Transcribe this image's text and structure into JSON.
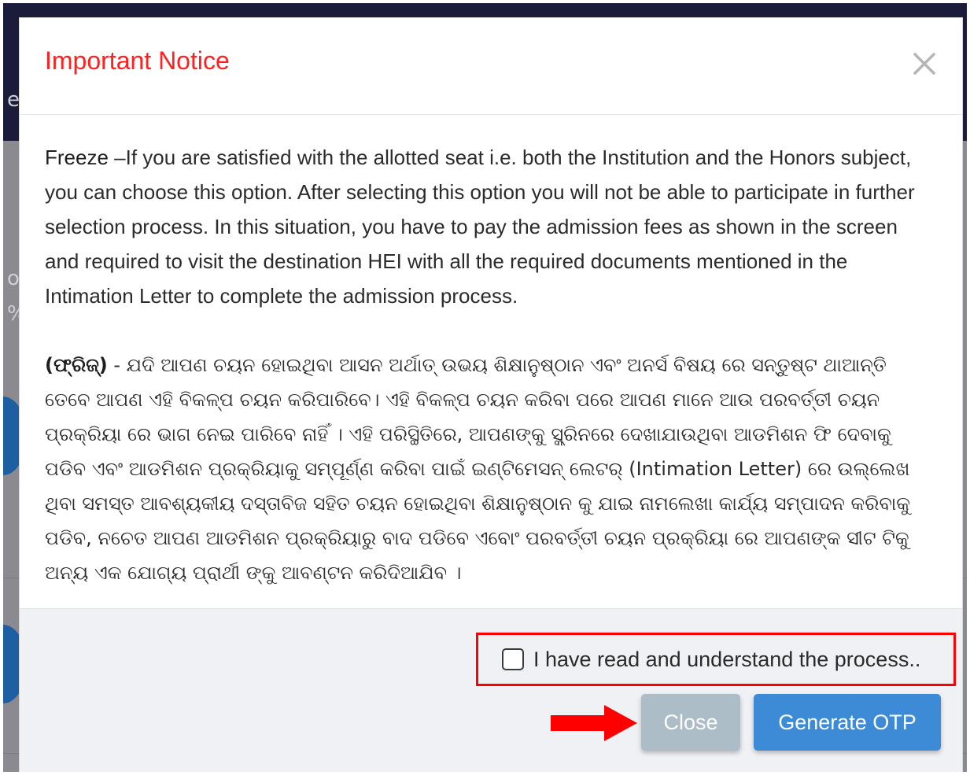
{
  "colors": {
    "title_red": "#ff2020",
    "highlight_red": "#ff0000",
    "close_button_bg": "#adbdc8",
    "primary_button_bg": "#3d8bd6"
  },
  "modal": {
    "title": "Important Notice",
    "close_icon": "close-icon",
    "body": {
      "english": {
        "lead": "Freeze",
        "text": " –If you are satisfied with the allotted seat i.e. both the Institution and the Honors subject, you can choose this option. After selecting this option you will not be able to participate in further selection process. In this situation, you have to pay the admission fees as shown in the screen and required to visit the destination HEI with all the required documents mentioned in the Intimation Letter to complete the admission process."
      },
      "odia": {
        "lead": "(ଫ୍ରିଜ୍)",
        "text": " - ଯଦି ଆପଣ ଚୟନ ହୋଇଥିବା ଆସନ ଅର୍ଥାତ୍ ଉଭୟ ଶିକ୍ଷାନୁଷ୍ଠାନ ଏବଂ ଅନର୍ସ ବିଷୟ ରେ ସନ୍ତୁଷ୍ଟ ଥାଆନ୍ତି ତେବେ ଆପଣ ଏହି ବିକଳ୍ପ ଚୟନ କରିପାରିବେ। ଏହି ବିକଳ୍ପ ଚୟନ କରିବା ପରେ ଆପଣ ମାନେ ଆଉ ପରବର୍ତ୍ତୀ ଚୟନ ପ୍ରକ୍ରିୟା ରେ ଭାଗ ନେଇ ପାରିବେ ନାହିଁ । ଏହି ପରିସ୍ଥିତିରେ, ଆପଣଙ୍କୁ ସ୍କ୍ରିନରେ ଦେଖାଯାଉଥିବା ଆଡମିଶନ ଫି ଦେବାକୁ ପଡିବ ଏବଂ ଆଡମିଶନ ପ୍ରକ୍ରିୟାକୁ ସମ୍ପୂର୍ଣ୍ଣ କରିବା ପାଇଁ ଇଣ୍ଟିମେସନ୍ ଲେଟର୍ (Intimation Letter) ରେ ଉଲ୍ଲେଖ ଥିବା ସମସ୍ତ ଆବଶ୍ୟକୀୟ ଦସ୍ତାବିଜ ସହିତ ଚୟନ ହୋଇଥିବା ଶିକ୍ଷାନୁଷ୍ଠାନ କୁ ଯାଇ ନାମଲେଖା କାର୍ଯ୍ୟ ସମ୍ପାଦନ କରିବାକୁ ପଡିବ, ନଚେତ ଆପଣ ଆଡମିଶନ ପ୍ରକ୍ରିୟାରୁ ବାଦ ପଡିବେ ଏବୋଂ ପରବର୍ତ୍ତୀ ଚୟନ ପ୍ରକ୍ରିୟା ରେ ଆପଣଙ୍କ ସୀଟ ଟିକୁ ଅନ୍ୟ ଏକ ଯୋଗ୍ୟ ପ୍ରାର୍ଥୀ ଙ୍କୁ ଆବଣ୍ଟନ କରିଦିଆଯିବ ।"
      }
    },
    "footer": {
      "consent_label": "I have read and understand the process..",
      "consent_checked": false,
      "close_label": "Close",
      "generate_otp_label": "Generate OTP"
    }
  }
}
